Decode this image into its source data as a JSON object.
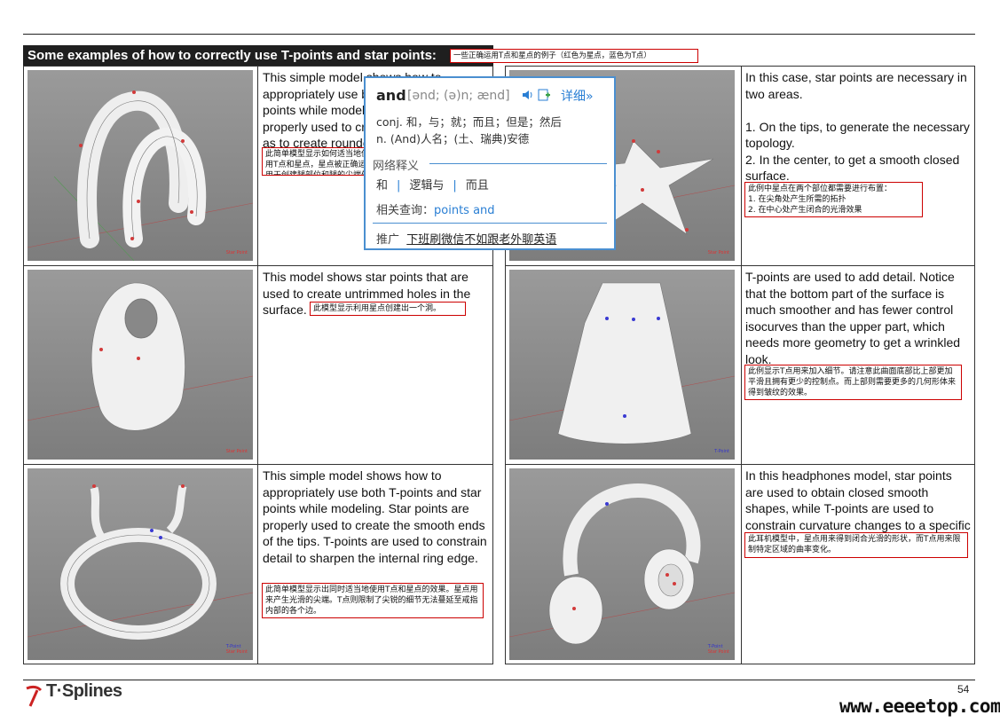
{
  "header": {
    "title": "Some examples of how to correctly use T-points and star points:",
    "title_cn": "一些正确运用T点和星点的例子（红色为星点，蓝色为T点）"
  },
  "panels": [
    {
      "text": "This simple model shows how to appropriately use both T-points and star points while modeling. Star points are properly used to create the \"legs\" as well as to create rounded tips.",
      "cn": "此简单模型显示如何适当地使用T点和星点，星点被正确运用于创建腿部位和腿的尖端处合理布置。",
      "legend": [
        "Star Point"
      ]
    },
    {
      "text": "In this case, star points are necessary in two areas.\n\n1. On the tips, to generate the necessary topology.\n2. In the center, to get a smooth closed surface.",
      "cn": "此例中星点在两个部位都需要进行布置：\n1. 在尖角处产生所需的拓扑\n2. 在中心处产生闭合的光滑效果",
      "legend": [
        "Star Point"
      ]
    },
    {
      "text": "This model shows star points that are used to create untrimmed holes in the surface.",
      "cn": "此模型显示利用星点创建出一个洞。",
      "legend": [
        "Star Point"
      ]
    },
    {
      "text": "T-points are used to add detail. Notice that the bottom part of the surface is much smoother and has fewer control isocurves than the upper part, which needs more geometry to get a wrinkled look.",
      "cn": "此例显示T点用来加入细节。请注意此曲面底部比上部更加平滑且拥有更少的控制点。而上部则需要更多的几何形体来得到皱纹的效果。",
      "legend": [
        "T-Point"
      ]
    },
    {
      "text": "This simple model shows how to appropriately use both T-points and star points while modeling. Star points are properly used to create the smooth ends of the tips. T-points are used to constrain detail to sharpen the internal ring edge.",
      "cn": "此简单模型显示出同时适当地使用T点和星点的效果。星点用来产生光滑的尖端。T点则限制了尖锐的细节无法蔓延至戒指内部的各个边。",
      "legend": [
        "T-Point",
        "Star Point"
      ]
    },
    {
      "text": "In this headphones model, star points are used to obtain closed smooth shapes, while T-points are used to constrain curvature changes to a specific area.",
      "cn": "此耳机模型中，星点用来得到闭合光滑的形状，而T点用来限制特定区域的曲率变化。",
      "legend": [
        "T-Point",
        "Star Point"
      ]
    }
  ],
  "dictionary_popup": {
    "word": "and",
    "phonetic": "[ənd; (ə)n; ænd]",
    "more_label": "详细»",
    "defs": [
      "conj. 和，与；就；而且；但是；然后",
      "n. (And)人名；(土、瑞典)安德"
    ],
    "net_title": "网络释义",
    "net_items": [
      "和",
      "逻辑与",
      "而且"
    ],
    "related_label": "相关查询：",
    "related_link": "points and",
    "ad_label": "推广",
    "ad_link": "下班刷微信不如跟老外聊英语"
  },
  "footer": {
    "logo": "T·Splines",
    "page_number": "54",
    "watermark": "www.eeeetop.com"
  },
  "colors": {
    "star_point": "#d23a3a",
    "t_point": "#3a3ad2",
    "popup_border": "#4a8fd0",
    "annotation_border": "#cc0000"
  }
}
